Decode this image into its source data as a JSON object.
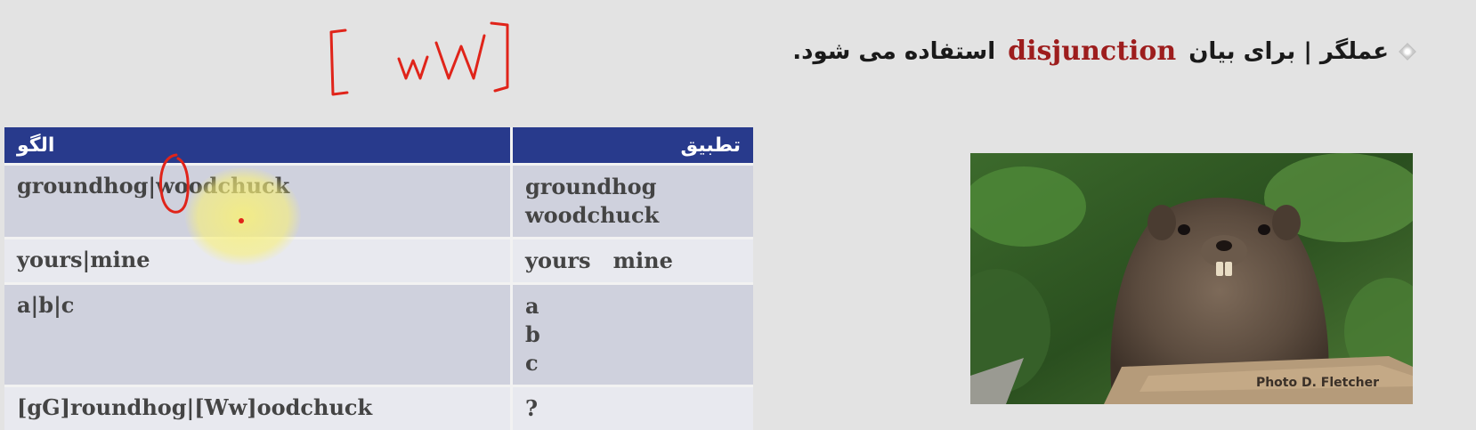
{
  "slide": {
    "bullet": {
      "before": "عملگر | برای بیان",
      "keyword": "disjunction",
      "after": "استفاده می شود."
    },
    "annotation_text": "[wW]",
    "table": {
      "headers": {
        "pattern": "الگو",
        "match": "تطبیق"
      },
      "rows": [
        {
          "pattern": "groundhog|woodchuck",
          "matches": [
            "groundhog",
            "woodchuck"
          ]
        },
        {
          "pattern": "yours|mine",
          "matches": [
            "yours   mine"
          ]
        },
        {
          "pattern": "a|b|c",
          "matches": [
            "a",
            "b",
            "c"
          ]
        },
        {
          "pattern": "[gG]roundhog|[Ww]oodchuck",
          "matches": [
            "?"
          ]
        }
      ]
    },
    "photo": {
      "subject": "groundhog",
      "credit": "Photo D. Fletcher"
    }
  },
  "colors": {
    "background": "#e3e3e3",
    "header": "#283a8c",
    "keyword": "#9d1d1d",
    "row_odd": "#cfd1dd",
    "row_even": "#e8e9ef",
    "ink": "#e0241a"
  }
}
